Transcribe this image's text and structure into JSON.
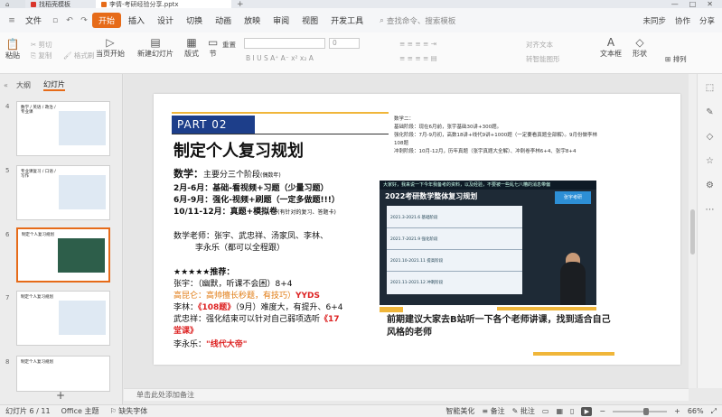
{
  "titlebar": {
    "tabs": [
      {
        "label": "",
        "icon": "home-icon"
      },
      {
        "label": "找稻壳模板",
        "icon": "wps-icon"
      },
      {
        "label": "李倩-考研经验分享.pptx",
        "icon": "ppt-icon"
      }
    ],
    "window_buttons": [
      "□",
      "—",
      "□",
      "✕"
    ]
  },
  "menubar": {
    "file_label": "文件",
    "items": [
      "开始",
      "插入",
      "设计",
      "切换",
      "动画",
      "放映",
      "审阅",
      "视图",
      "开发工具"
    ],
    "active": "开始",
    "search_placeholder": "查找命令、搜索模板",
    "right": [
      "未同步",
      "协作",
      "分享"
    ]
  },
  "ribbon": {
    "buttons": [
      {
        "label": "粘贴",
        "icon": "paste-icon"
      },
      {
        "label": "剪切",
        "icon": "cut-icon"
      },
      {
        "label": "复制",
        "icon": "copy-icon"
      },
      {
        "label": "格式刷",
        "icon": "format-painter-icon"
      },
      {
        "label": "当页开始",
        "icon": "play-icon"
      },
      {
        "label": "新建幻灯片",
        "icon": "new-slide-icon"
      },
      {
        "label": "版式",
        "icon": "layout-icon"
      },
      {
        "label": "节",
        "icon": "section-icon"
      },
      {
        "label": "重置",
        "icon": "reset-icon"
      },
      {
        "label": "文本框",
        "icon": "textbox-icon"
      },
      {
        "label": "形状",
        "icon": "shape-icon"
      },
      {
        "label": "排列",
        "icon": "arrange-icon"
      }
    ],
    "right_small": [
      "对齐文本",
      "转智能图形"
    ],
    "font_size_placeholder": "0"
  },
  "leftpanel": {
    "tabs": [
      "大纲",
      "幻灯片"
    ],
    "active_tab": "幻灯片",
    "slides": [
      {
        "num": "4",
        "title": "数学 / 英语 / 政治 / 专业课"
      },
      {
        "num": "5",
        "title": "专业课复习 / 口语 / 写作"
      },
      {
        "num": "6",
        "title": "制定个人复习规划"
      },
      {
        "num": "7",
        "title": "制定个人复习规划"
      },
      {
        "num": "8",
        "title": "制定个人复习规划"
      }
    ],
    "add_label": "+"
  },
  "slide": {
    "part": "PART 02",
    "title": "制定个人复习规划",
    "math_heading": "数学：",
    "math_desc": "主要分三个阶段",
    "math_note": "(偶数年)",
    "stage1": "2月-6月：基础-看视频+习题（少量习题）",
    "stage2": "6月-9月：强化-视频+刷题（一定多做题!!!）",
    "stage3": "10/11-12月：真题+模拟卷",
    "stage3_note": "(有针对的复习、答题卡)",
    "teachers_line1": "数学老师：张宇、武忠祥、汤家凤、李林、",
    "teachers_line2": "李永乐（都可以全程跟）",
    "rec_heading": "★★★★★推荐：",
    "rec1": "张宇：（幽默，听课不会困）8+4",
    "rec2a": "高昆仑：高帅擅长秒题，有技巧）",
    "rec2b": "YYDS",
    "rec3a": "李林：",
    "rec3b": "《108题》",
    "rec3c": "（9月）难度大，有提升、6+4",
    "rec4a": "武忠祥：强化结束可以针对自己弱项选听",
    "rec4b": "《17",
    "rec4c": "堂课》",
    "rec5a": "李永乐：",
    "rec5b": "\"线代大帝\"",
    "notes_text": "数学二：\n基础阶段：现在6月前，张宇基础30讲+300题。\n强化阶段：7月-9月初，高数18讲+线代9讲+1000题（一定要看真题全部解）。9月份做李林108题\n冲刺阶段：10月-12月，历年真题（张宇真题大全解）、冲刺卷李林6+4、张宇8+4",
    "video_banner": "大家好，我来说一下今年我备考的资料，以及经验，不要被一些乱七八糟的消息带偏",
    "video_title": "2022考研数学整体复习规划",
    "video_logo": "张宇考研",
    "video_rows": [
      "2021.3-2021.6 基础阶段",
      "2021.7-2021.9 强化阶段",
      "2021.10-2021.11 提高阶段",
      "2021.11-2021.12 冲刺阶段"
    ],
    "caption": "前期建议大家去B站听一下各个老师讲课，找到适合自己风格的老师"
  },
  "notes_placeholder": "单击此处添加备注",
  "status": {
    "slide_count": "幻灯片 6 / 11",
    "theme": "Office 主题",
    "font_missing": "缺失字体",
    "smart": "智能美化",
    "notes": "备注",
    "comments": "批注",
    "zoom": "66%"
  },
  "colors": {
    "accent": "#e66b19",
    "part_box": "#1d3e8a",
    "highlight": "#d22"
  }
}
